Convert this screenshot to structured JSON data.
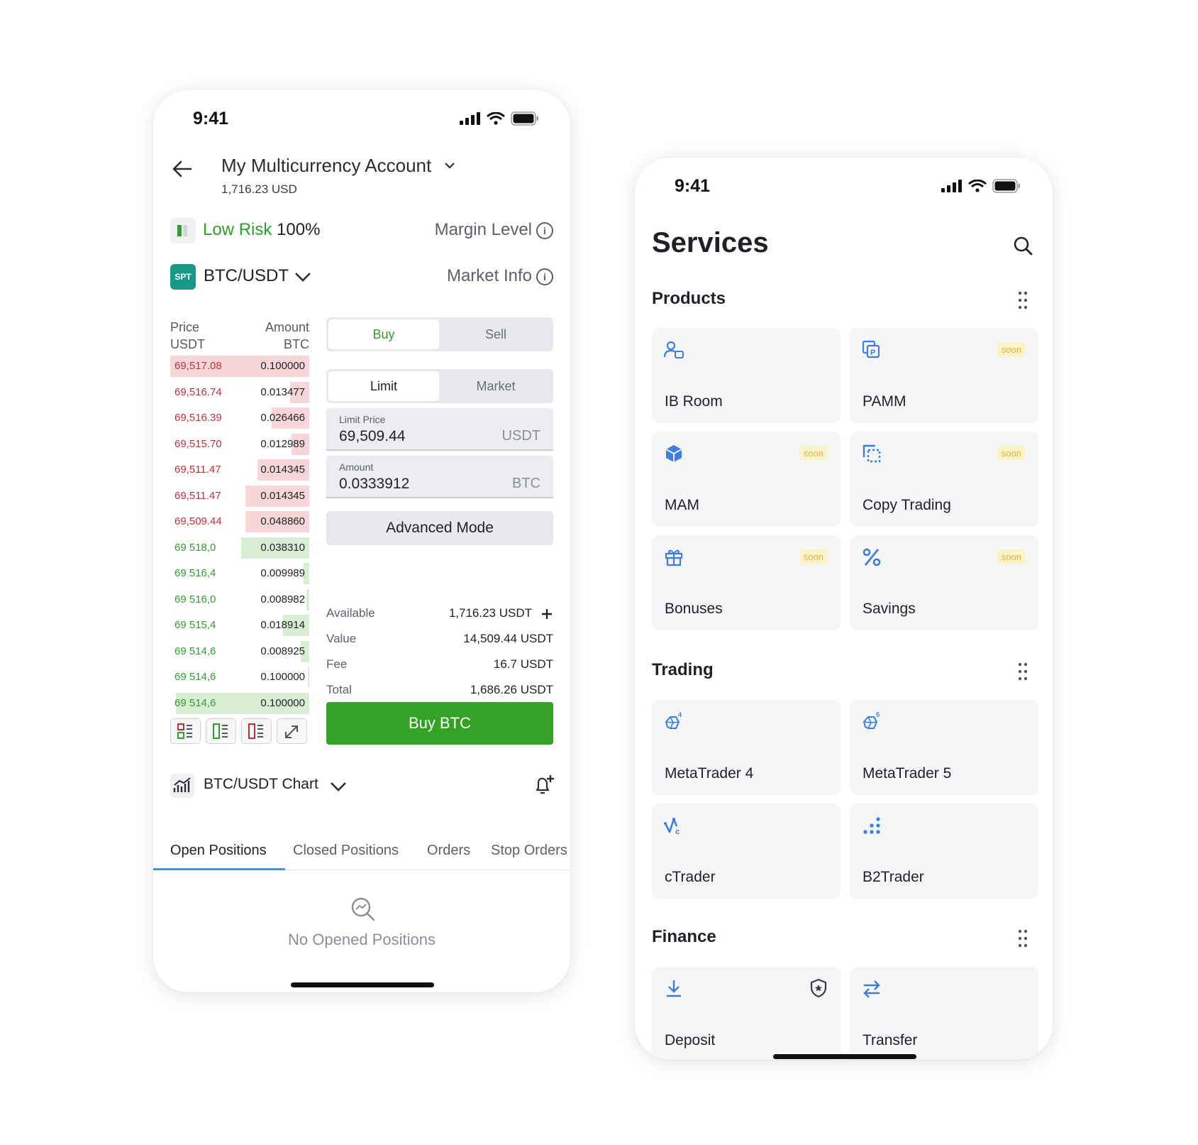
{
  "left": {
    "status_time": "9:41",
    "account": {
      "name": "My Multicurrency Account",
      "balance": "1,716.23 USD"
    },
    "risk": {
      "label": "Low Risk",
      "percent": "100%",
      "margin_label": "Margin Level"
    },
    "pair": {
      "badge": "SPT",
      "symbol": "BTC/USDT",
      "market_info": "Market Info"
    },
    "orderbook": {
      "price_header": "Price",
      "price_unit": "USDT",
      "amount_header": "Amount",
      "amount_unit": "BTC",
      "asks": [
        {
          "price": "69,517.08",
          "amount": "0.100000",
          "depth": 1.0
        },
        {
          "price": "69,516.74",
          "amount": "0.013477",
          "depth": 0.14
        },
        {
          "price": "69,516.39",
          "amount": "0.026466",
          "depth": 0.27
        },
        {
          "price": "69,515.70",
          "amount": "0.012989",
          "depth": 0.13
        },
        {
          "price": "69,511.47",
          "amount": "0.014345",
          "depth": 0.37
        },
        {
          "price": "69,511.47",
          "amount": "0.014345",
          "depth": 0.46
        },
        {
          "price": "69,509.44",
          "amount": "0.048860",
          "depth": 0.46
        }
      ],
      "bids": [
        {
          "price": "69 518,0",
          "amount": "0.038310",
          "depth": 0.49
        },
        {
          "price": "69 516,4",
          "amount": "0.009989",
          "depth": 0.04
        },
        {
          "price": "69 516,0",
          "amount": "0.008982",
          "depth": 0.02
        },
        {
          "price": "69 515,4",
          "amount": "0.018914",
          "depth": 0.19
        },
        {
          "price": "69 514,6",
          "amount": "0.008925",
          "depth": 0.06
        },
        {
          "price": "69 514,6",
          "amount": "0.100000",
          "depth": 0.01
        },
        {
          "price": "69 514,6",
          "amount": "0.100000",
          "depth": 0.96
        }
      ]
    },
    "side_toggle": {
      "buy": "Buy",
      "sell": "Sell"
    },
    "type_toggle": {
      "limit": "Limit",
      "market": "Market"
    },
    "limit_price": {
      "label": "Limit Price",
      "value": "69,509.44",
      "unit": "USDT"
    },
    "amount": {
      "label": "Amount",
      "value": "0.0333912",
      "unit": "BTC"
    },
    "advanced_mode": "Advanced Mode",
    "summary": [
      {
        "key": "Available",
        "value": "1,716.23 USDT"
      },
      {
        "key": "Value",
        "value": "14,509.44 USDT"
      },
      {
        "key": "Fee",
        "value": "16.7 USDT"
      },
      {
        "key": "Total",
        "value": "1,686.26 USDT"
      }
    ],
    "buy_button": "Buy BTC",
    "chart_label": "BTC/USDT Chart",
    "tabs": [
      "Open Positions",
      "Closed Positions",
      "Orders",
      "Stop Orders"
    ],
    "empty_state": "No Opened Positions",
    "colors": {
      "green": "#2e9f2a",
      "red": "#c0323a",
      "teal": "#17998a"
    }
  },
  "right": {
    "status_time": "9:41",
    "title": "Services",
    "sections": [
      {
        "title": "Products",
        "tiles": [
          {
            "label": "IB Room",
            "icon": "ib-room-icon",
            "soon": ""
          },
          {
            "label": "PAMM",
            "icon": "pamm-icon",
            "soon": "soon"
          },
          {
            "label": "MAM",
            "icon": "mam-icon",
            "soon": "soon"
          },
          {
            "label": "Copy Trading",
            "icon": "copy-trading-icon",
            "soon": "soon"
          },
          {
            "label": "Bonuses",
            "icon": "gift-icon",
            "soon": "soon"
          },
          {
            "label": "Savings",
            "icon": "percent-icon",
            "soon": "soon"
          }
        ]
      },
      {
        "title": "Trading",
        "tiles": [
          {
            "label": "MetaTrader 4",
            "icon": "metatrader4-icon",
            "soon": ""
          },
          {
            "label": "MetaTrader 5",
            "icon": "metatrader5-icon",
            "soon": ""
          },
          {
            "label": "cTrader",
            "icon": "ctrader-icon",
            "soon": ""
          },
          {
            "label": "B2Trader",
            "icon": "b2trader-icon",
            "soon": ""
          }
        ]
      },
      {
        "title": "Finance",
        "tiles": [
          {
            "label": "Deposit",
            "icon": "deposit-icon",
            "soon": ""
          },
          {
            "label": "Transfer",
            "icon": "transfer-icon",
            "soon": ""
          }
        ]
      }
    ],
    "colors": {
      "accent": "#3d7de0",
      "soon_bg": "#fdf3c9",
      "soon_text": "#d8b442"
    }
  }
}
